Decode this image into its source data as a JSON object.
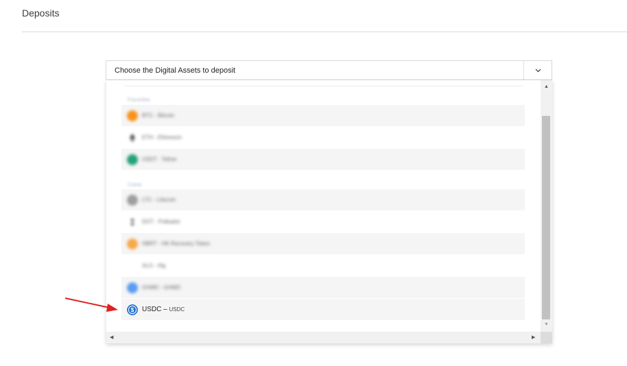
{
  "page": {
    "title": "Deposits"
  },
  "select": {
    "placeholder": "Choose the Digital Assets to deposit",
    "toggle_icon": "chevron-down-icon"
  },
  "dropdown": {
    "groups": [
      {
        "label": "Favorites"
      },
      {
        "label": "Coins"
      }
    ],
    "options": [
      {
        "label": "BTC - Bitcoin",
        "icon_color": "#f7931a"
      },
      {
        "label": "ETH - Ethereum",
        "icon_color": "#3c3c3d"
      },
      {
        "label": "USDT - Tether",
        "icon_color": "#26a17b"
      },
      {
        "label": "LTC - Litecoin",
        "icon_color": "#9e9e9e"
      },
      {
        "label": "DOT - Polkadot",
        "icon_color": "#444444"
      },
      {
        "label": "HBRT - HK Recovery Token",
        "icon_color": "#f7a94a"
      },
      {
        "label": "ALG - Alg",
        "icon_color": "#ffffff"
      },
      {
        "label": "GHMD - GHMD",
        "icon_color": "#5b9cf0"
      }
    ],
    "usdc": {
      "symbol": "USDC",
      "separator": "–",
      "name": "USDC",
      "icon_color": "#2775ca"
    }
  },
  "annotation": {
    "arrow_color": "#e02020"
  }
}
